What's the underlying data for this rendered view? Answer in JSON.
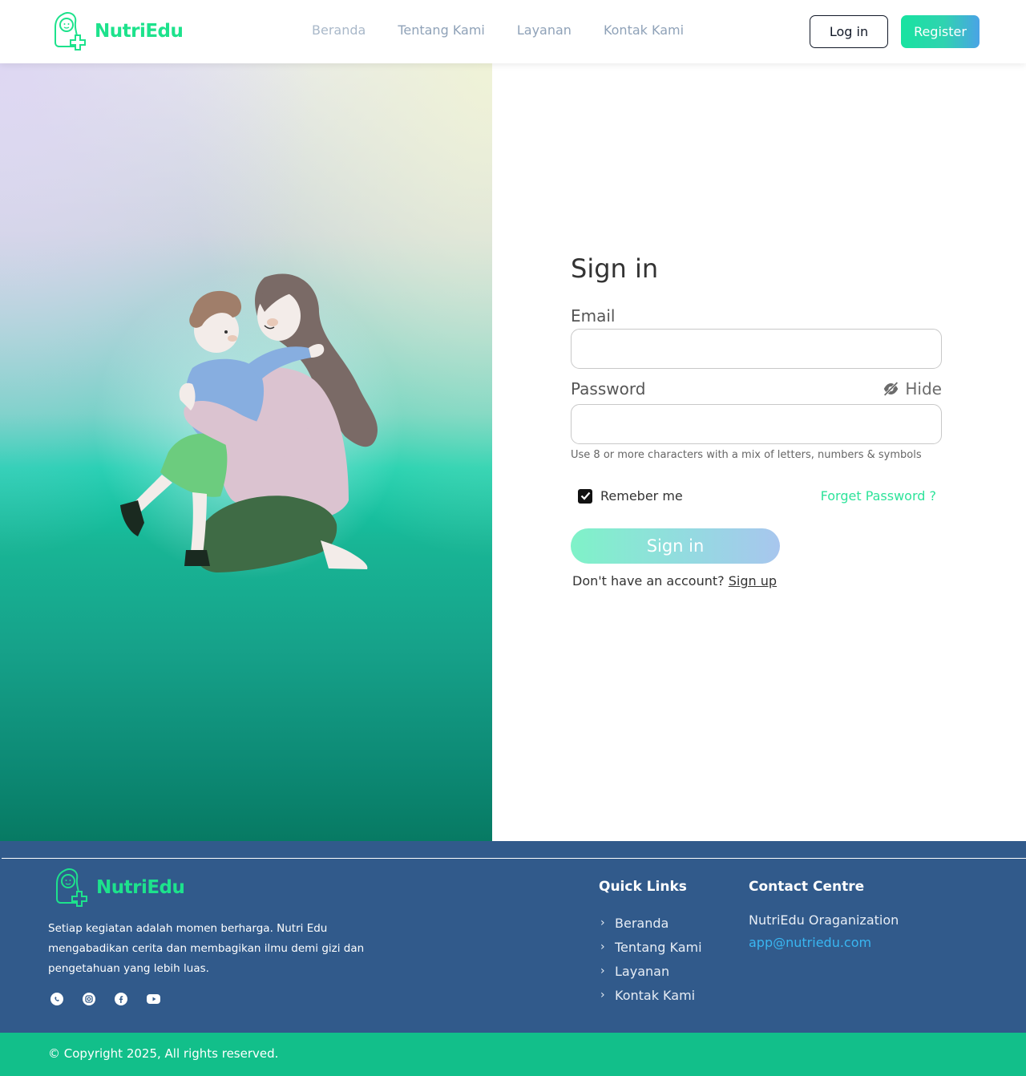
{
  "brand": {
    "name": "NutriEdu",
    "logo_icon": "baby-plus-logo-icon",
    "color": "#1de28c"
  },
  "nav": {
    "links": [
      "Beranda",
      "Tentang Kami",
      "Layanan",
      "Kontak Kami"
    ],
    "login_label": "Log in",
    "register_label": "Register"
  },
  "hero": {
    "illustration": "mother-hugging-child-illustration"
  },
  "form": {
    "title": "Sign in",
    "email_label": "Email",
    "email_value": "",
    "password_label": "Password",
    "hide_label": "Hide",
    "hide_icon": "eye-slash-icon",
    "password_value": "",
    "password_hint": "Use 8 or more characters with a mix of letters, numbers & symbols",
    "remember_label": "Remeber me",
    "remember_checked": true,
    "forgot_label": "Forget Password ?",
    "signin_button": "Sign in",
    "no_account_text": "Don't have an account?",
    "signup_link": "Sign up"
  },
  "footer": {
    "brand_name": "NutriEdu",
    "description": "Setiap kegiatan adalah momen berharga. Nutri Edu mengabadikan cerita dan membagikan ilmu demi gizi dan pengetahuan yang lebih luas.",
    "socials": [
      "whatsapp-icon",
      "instagram-icon",
      "facebook-icon",
      "youtube-icon"
    ],
    "quick_links_title": "Quick Links",
    "quick_links": [
      "Beranda",
      "Tentang Kami",
      "Layanan",
      "Kontak Kami"
    ],
    "contact_title": "Contact Centre",
    "contact_org": "NutriEdu Oraganization",
    "contact_email": "app@nutriedu.com",
    "copyright": "© Copyright 2025, All rights reserved."
  },
  "colors": {
    "accent_green": "#1de28c",
    "footer_bg": "#315a8b",
    "copyright_bg": "#12bf8a",
    "link_blue": "#39b6f1"
  }
}
